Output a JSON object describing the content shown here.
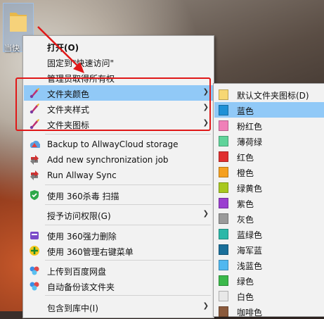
{
  "desktop_icon": {
    "label": "当快"
  },
  "menu": {
    "items": [
      {
        "label": "打开(O)",
        "bold": true
      },
      {
        "label": "固定到\"快速访问\""
      },
      {
        "label": "管理员取得所有权"
      },
      {
        "label": "文件夹颜色",
        "submenu": true,
        "icon": "brush-icon",
        "highlighted": true
      },
      {
        "label": "文件夹样式",
        "submenu": true,
        "icon": "brush-icon"
      },
      {
        "label": "文件夹图标",
        "submenu": true,
        "icon": "brush-icon"
      },
      {
        "label": "Backup to AllwayCloud storage",
        "icon": "allway-backup-icon"
      },
      {
        "label": "Add new synchronization job",
        "icon": "allway-add-icon"
      },
      {
        "label": "Run Allway Sync",
        "icon": "allway-run-icon"
      },
      {
        "label": "使用 360杀毒 扫描",
        "icon": "360-antivirus-icon"
      },
      {
        "label": "授予访问权限(G)",
        "submenu": true
      },
      {
        "label": "使用 360强力删除",
        "icon": "360-delete-icon"
      },
      {
        "label": "使用 360管理右键菜单",
        "icon": "360-manager-icon"
      },
      {
        "label": "上传到百度网盘",
        "icon": "baidu-upload-icon"
      },
      {
        "label": "自动备份该文件夹",
        "icon": "baidu-backup-icon"
      },
      {
        "label": "包含到库中(I)",
        "submenu": true
      }
    ]
  },
  "color_submenu": {
    "items": [
      {
        "label": "默认文件夹图标(D)",
        "color": "#f7d774"
      },
      {
        "label": "蓝色",
        "color": "#1e90d6",
        "highlighted": true
      },
      {
        "label": "粉红色",
        "color": "#f080b8"
      },
      {
        "label": "薄荷绿",
        "color": "#5fd39a"
      },
      {
        "label": "红色",
        "color": "#e03030"
      },
      {
        "label": "橙色",
        "color": "#f5a020"
      },
      {
        "label": "绿黄色",
        "color": "#a8c820"
      },
      {
        "label": "紫色",
        "color": "#9b3fd0"
      },
      {
        "label": "灰色",
        "color": "#9a9a9a"
      },
      {
        "label": "蓝绿色",
        "color": "#2bb8a8"
      },
      {
        "label": "海军蓝",
        "color": "#1a6f9a"
      },
      {
        "label": "浅蓝色",
        "color": "#50b8f0"
      },
      {
        "label": "绿色",
        "color": "#3ab84a"
      },
      {
        "label": "白色",
        "color": "#e8e8e8"
      },
      {
        "label": "咖啡色",
        "color": "#8b5a3c"
      }
    ]
  }
}
